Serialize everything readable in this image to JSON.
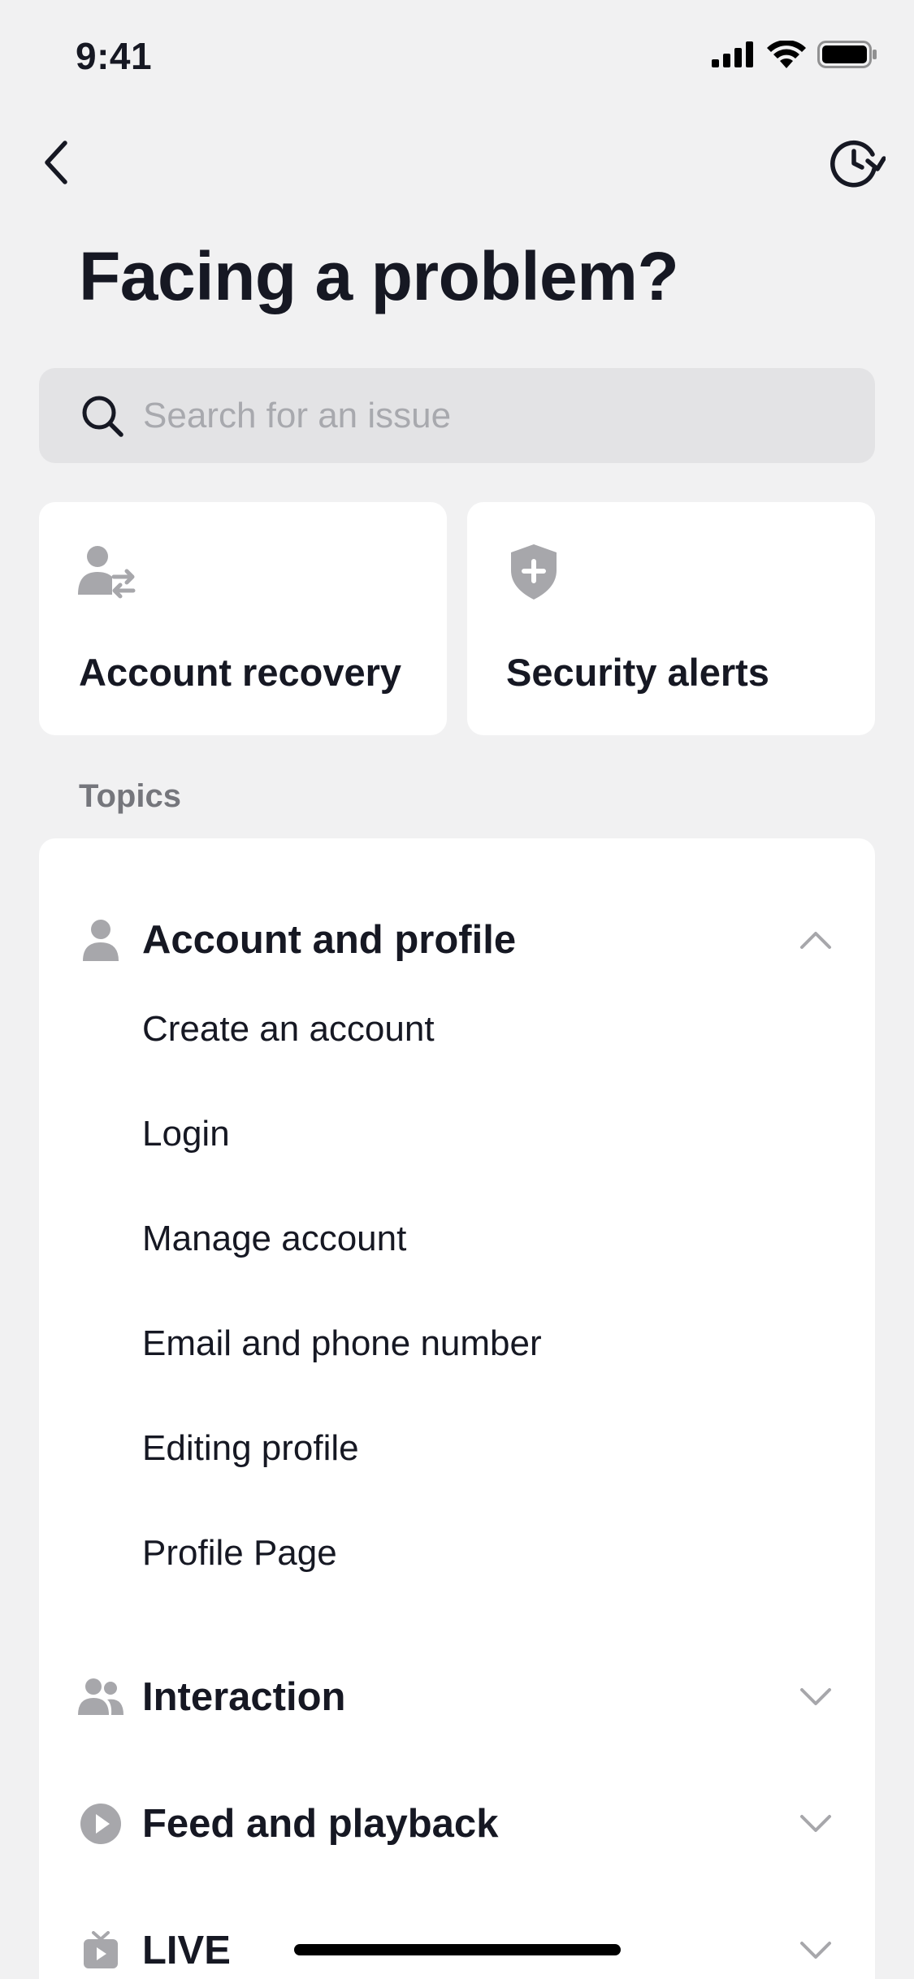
{
  "status_bar": {
    "time": "9:41"
  },
  "nav": {
    "back": "back-icon",
    "history": "history-icon"
  },
  "page_title": "Facing a problem?",
  "search": {
    "placeholder": "Search for an issue",
    "value": ""
  },
  "quick_actions": [
    {
      "label": "Account recovery",
      "icon": "account-switch-icon"
    },
    {
      "label": "Security alerts",
      "icon": "shield-plus-icon"
    }
  ],
  "topics_heading": "Topics",
  "topics": [
    {
      "label": "Account and profile",
      "icon": "person-icon",
      "expanded": true,
      "items": [
        "Create an account",
        "Login",
        "Manage account",
        "Email and phone number",
        "Editing profile",
        "Profile Page"
      ]
    },
    {
      "label": "Interaction",
      "icon": "people-icon",
      "expanded": false
    },
    {
      "label": "Feed and playback",
      "icon": "play-circle-icon",
      "expanded": false
    },
    {
      "label": "LIVE",
      "icon": "live-tv-icon",
      "expanded": false
    }
  ],
  "colors": {
    "background": "#f1f1f2",
    "card": "#ffffff",
    "search_bg": "#e3e3e5",
    "muted_icon": "#a7a7ab",
    "text": "#161823"
  }
}
